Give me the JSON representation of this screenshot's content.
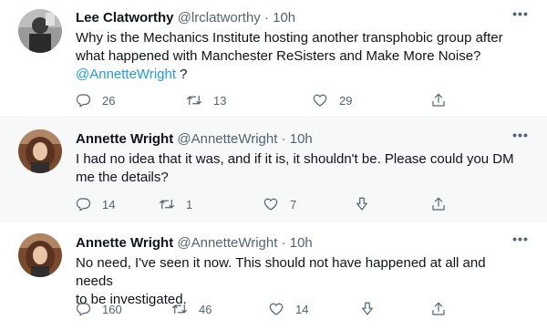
{
  "tweets": [
    {
      "name": "Lee Clatworthy",
      "handle": "@lrclatworthy",
      "separator": "·",
      "time": "10h",
      "more": "•••",
      "text_line1": "Why is the Mechanics Institute hosting another transphobic group after",
      "text_line2": "what happened with Manchester ReSisters and Make More Noise?",
      "mention": "@AnnetteWright",
      "text_tail": " ?",
      "replies": "26",
      "retweets": "13",
      "likes": "29"
    },
    {
      "name": "Annette Wright",
      "handle": "@AnnetteWright",
      "separator": "·",
      "time": "10h",
      "more": "•••",
      "text_line1": "I had no idea that it was, and if it is, it shouldn't be. Please could you DM",
      "text_line2": "me the details?",
      "replies": "14",
      "retweets": "1",
      "likes": "7"
    },
    {
      "name": "Annette Wright",
      "handle": "@AnnetteWright",
      "separator": "·",
      "time": "10h",
      "more": "•••",
      "text_line1": "No need, I've seen it now. This should not have happened at all and needs",
      "text_line2": "to be investigated.",
      "replies": "160",
      "retweets": "46",
      "likes": "14"
    }
  ],
  "colors": {
    "text": "#0f1419",
    "secondary": "#536471",
    "link": "#1d9bf0",
    "highlight_bg": "#f7f9f9",
    "divider": "#eff3f4"
  },
  "icons": [
    "reply-icon",
    "retweet-icon",
    "like-icon",
    "downvote-icon",
    "share-icon",
    "more-icon"
  ]
}
